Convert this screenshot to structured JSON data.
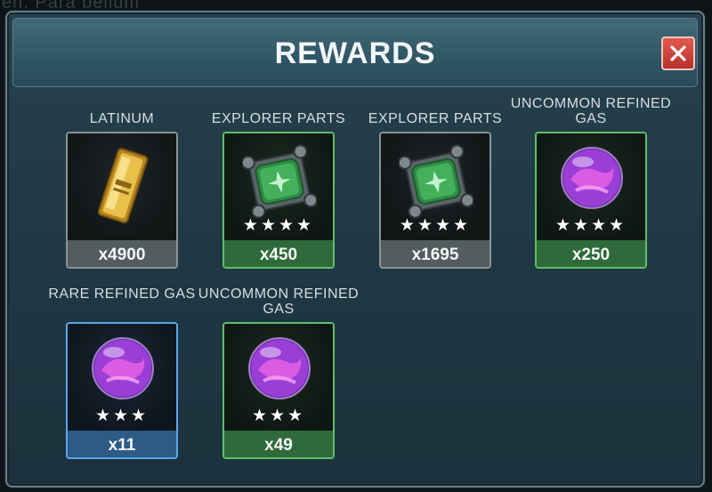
{
  "background_text": "en. Para bellum",
  "window": {
    "title": "REWARDS"
  },
  "rewards": [
    {
      "name": "LATINUM",
      "quantity": "x4900",
      "rarity": "common",
      "rarity_color": "#8a9498",
      "stars": "",
      "icon": "latinum-bar-icon"
    },
    {
      "name": "EXPLORER PARTS",
      "quantity": "x450",
      "rarity": "uncommon",
      "rarity_color": "#5fbf6a",
      "stars": "★★★★",
      "icon": "explorer-parts-icon"
    },
    {
      "name": "EXPLORER PARTS",
      "quantity": "x1695",
      "rarity": "common",
      "rarity_color": "#8a9498",
      "stars": "★★★★",
      "icon": "explorer-parts-icon"
    },
    {
      "name": "UNCOMMON REFINED GAS",
      "quantity": "x250",
      "rarity": "uncommon",
      "rarity_color": "#5fbf6a",
      "stars": "★★★★",
      "icon": "refined-gas-orb-icon"
    },
    {
      "name": "RARE REFINED GAS",
      "quantity": "x11",
      "rarity": "rare",
      "rarity_color": "#5aa7e8",
      "stars": "★★★",
      "icon": "refined-gas-orb-icon"
    },
    {
      "name": "UNCOMMON REFINED GAS",
      "quantity": "x49",
      "rarity": "uncommon",
      "rarity_color": "#5fbf6a",
      "stars": "★★★",
      "icon": "refined-gas-orb-icon"
    }
  ],
  "close_icon": "close-icon"
}
